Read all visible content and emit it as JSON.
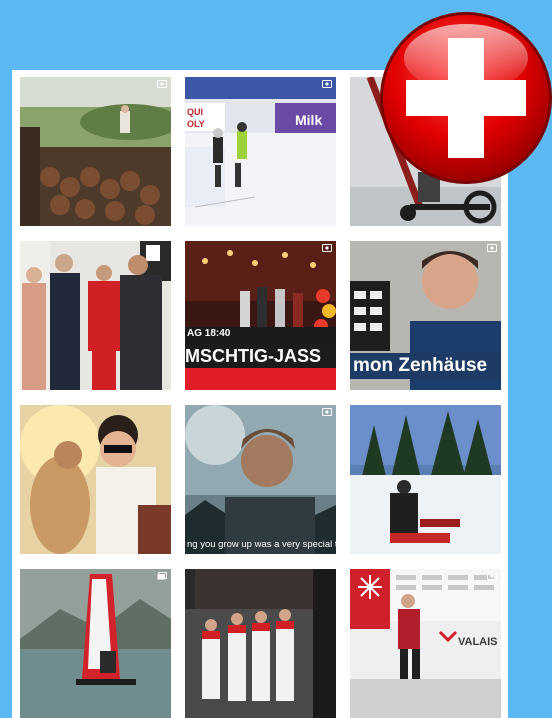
{
  "tiles": [
    {
      "id": "garden",
      "media": "video",
      "caption": ""
    },
    {
      "id": "ski-race",
      "media": "video",
      "caption": ""
    },
    {
      "id": "scooter",
      "media": "video",
      "caption": ""
    },
    {
      "id": "group-photo",
      "media": "none",
      "caption": ""
    },
    {
      "id": "tv-show",
      "media": "video",
      "caption_top": "AG 18:40",
      "caption_band": "MSCHTIG-JASS"
    },
    {
      "id": "interview",
      "media": "video",
      "caption_band": "mon Zenhäuse"
    },
    {
      "id": "selfie-camel",
      "media": "none",
      "caption": ""
    },
    {
      "id": "portrait-sunset",
      "media": "video",
      "caption_sub": "ng you grow up was a very special thing"
    },
    {
      "id": "snow-sled",
      "media": "none",
      "caption": ""
    },
    {
      "id": "windsurf",
      "media": "gallery",
      "caption": ""
    },
    {
      "id": "team-suits",
      "media": "none",
      "caption": ""
    },
    {
      "id": "valais-booth",
      "media": "video",
      "caption_logo": "VALAIS"
    }
  ],
  "badge": {
    "icon": "swiss-flag-icon",
    "colors": {
      "red": "#e10000",
      "white": "#ffffff"
    }
  },
  "colors": {
    "background": "#5cb8f0",
    "panel": "#ffffff"
  }
}
